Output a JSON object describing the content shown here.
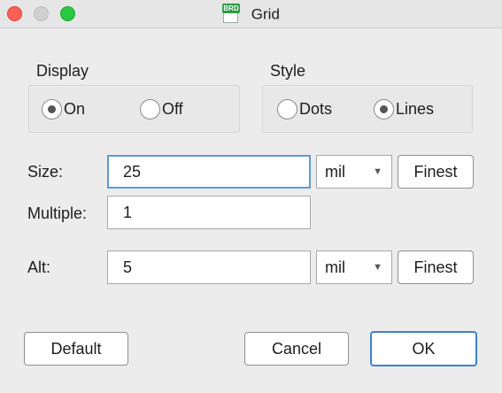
{
  "window": {
    "title": "Grid",
    "icon_badge": "BRD"
  },
  "display": {
    "label": "Display",
    "options": [
      {
        "label": "On",
        "checked": true
      },
      {
        "label": "Off",
        "checked": false
      }
    ]
  },
  "style": {
    "label": "Style",
    "options": [
      {
        "label": "Dots",
        "checked": false
      },
      {
        "label": "Lines",
        "checked": true
      }
    ]
  },
  "size": {
    "label": "Size:",
    "value": "25",
    "unit": "mil",
    "finest_label": "Finest"
  },
  "multiple": {
    "label": "Multiple:",
    "value": "1"
  },
  "alt": {
    "label": "Alt:",
    "value": "5",
    "unit": "mil",
    "finest_label": "Finest"
  },
  "buttons": {
    "default": "Default",
    "cancel": "Cancel",
    "ok": "OK"
  },
  "colors": {
    "accent": "#3b82d1",
    "close": "#fe5f57",
    "maximize": "#28c840"
  }
}
